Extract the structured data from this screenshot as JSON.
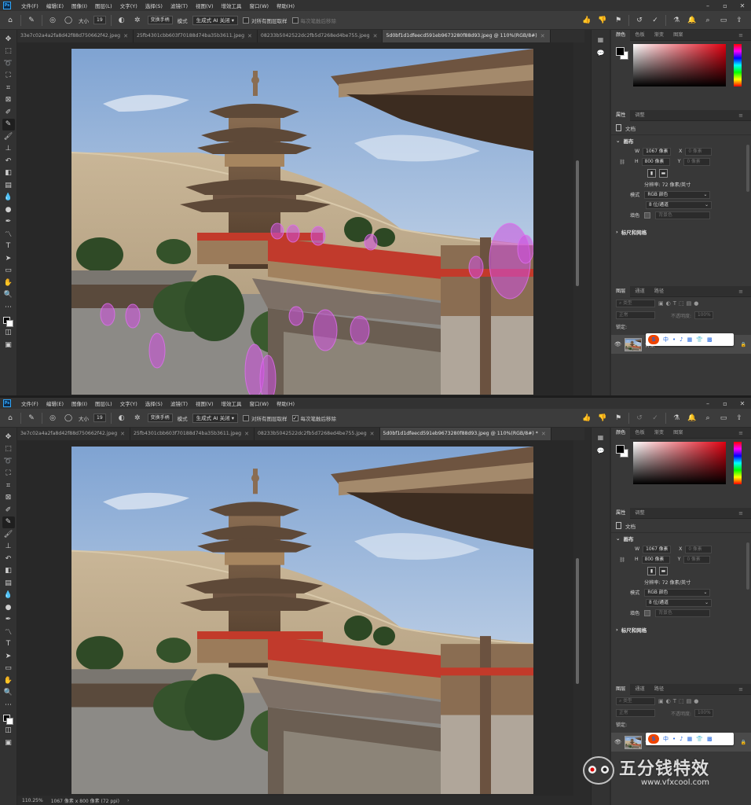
{
  "menu": [
    "文件(F)",
    "编辑(E)",
    "图像(I)",
    "图层(L)",
    "文字(Y)",
    "选择(S)",
    "滤镜(T)",
    "视图(V)",
    "增效工具",
    "窗口(W)",
    "帮助(H)"
  ],
  "app_logo": "Ps",
  "window_controls": [
    "–",
    "▫",
    "✕"
  ],
  "options": {
    "size_label": "大小",
    "size_value": "19",
    "brush_mode_button": "变换手柄",
    "mode_label": "模式",
    "mode_value": "生成式 AI 关闭",
    "sample_all_layers": "对所有图层取样",
    "remove_after_stroke": "每次笔触后移除"
  },
  "top": {
    "tabs": [
      {
        "label": "33e7c02a4a2fa8d42f88d750662f42.jpeg",
        "active": false
      },
      {
        "label": "25fb4301cbb603f70188d74ba35b3611.jpeg",
        "active": false
      },
      {
        "label": "08233b5042522dc2fb5d7268ed4be755.jpeg",
        "active": false
      },
      {
        "label": "5d0bf1d1dfeecd591eb9673280f88d93.jpeg @ 110%(RGB/8#)",
        "active": true
      }
    ],
    "remove_after_stroke_checked": false
  },
  "bottom": {
    "tabs": [
      {
        "label": "3e7c02a4a2fa8d42f88d750662f42.jpeg",
        "active": false
      },
      {
        "label": "25fb4301cbb603f70188d74ba35b3611.jpeg",
        "active": false
      },
      {
        "label": "08233b5042522dc2fb5d7268ed4be755.jpeg",
        "active": false
      },
      {
        "label": "5d0bf1d1dfeecd591eb9673280f88d93.jpeg @ 110%(RGB/8#) *",
        "active": true
      }
    ],
    "remove_after_stroke_checked": true,
    "status": {
      "zoom": "110.25%",
      "doc_size": "1067 像素 x 800 像素 (72 ppi)"
    }
  },
  "panels": {
    "color_tabs": [
      "颜色",
      "色板",
      "渐变",
      "图案"
    ],
    "props_tabs": [
      "属性",
      "调整"
    ],
    "doc_label": "文档",
    "canvas_section": "画布",
    "width_label": "W",
    "width_value": "1067 像素",
    "height_label": "H",
    "height_value": "800 像素",
    "x_label": "X",
    "x_placeholder": "0 像素",
    "y_label": "Y",
    "y_placeholder": "0 像素",
    "resolution": "分辨率: 72 像素/英寸",
    "mode_label": "模式",
    "mode_value": "RGB 颜色",
    "depth_value": "8 位/通道",
    "fill_label": "填色",
    "fill_value": "背景色",
    "rulers_section": "标尺和网格",
    "layers_tabs": [
      "图层",
      "通道",
      "路径"
    ],
    "layers_search": "类型",
    "blend_mode": "正常",
    "opacity_label": "不透明度:",
    "opacity_value": "100%",
    "lock_label": "锁定:",
    "fill_label2": "填充:",
    "layer_name": "背景"
  },
  "ime": {
    "logo": "S",
    "items": [
      "中",
      "•",
      "♪",
      "▦",
      "👕",
      "▩"
    ]
  },
  "watermark": {
    "title": "五分钱特效",
    "url": "www.vfxcool.com"
  },
  "colors": {
    "accent": "#31a8ff",
    "selection_overlay": "#d050e0",
    "panel_bg": "#383838",
    "canvas_bg": "#282828"
  }
}
